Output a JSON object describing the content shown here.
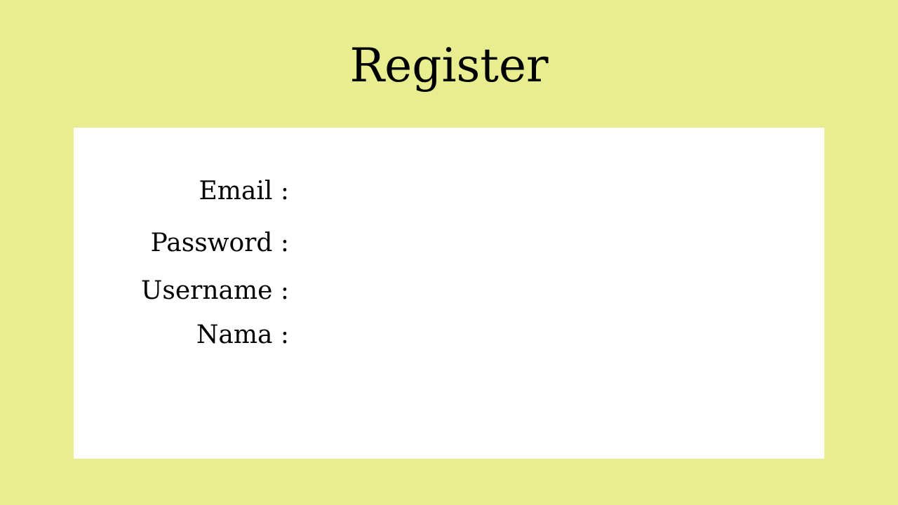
{
  "page": {
    "title": "Register",
    "background_color": "#e8ed8f",
    "card_color": "#ffffff"
  },
  "form": {
    "fields": [
      {
        "label": "Email :",
        "value": "",
        "placeholder": ""
      },
      {
        "label": "Password :",
        "value": "",
        "placeholder": ""
      },
      {
        "label": "Username :",
        "value": "",
        "placeholder": ""
      },
      {
        "label": "Nama :",
        "value": "",
        "placeholder": ""
      }
    ]
  }
}
